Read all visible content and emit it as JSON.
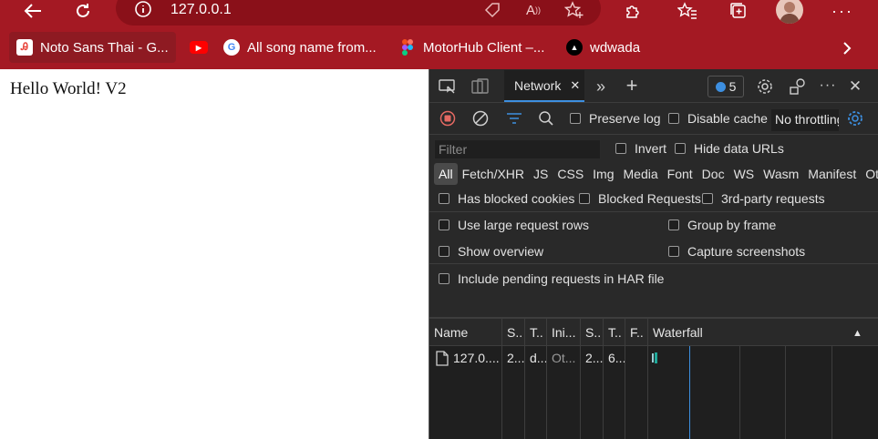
{
  "browser": {
    "address_url": "127.0.0.1",
    "bookmarks": [
      {
        "label": "Noto Sans Thai - G...",
        "icon": "google-fonts-icon"
      },
      {
        "label": "",
        "icon": "youtube-icon"
      },
      {
        "label": "All song name from...",
        "icon": "google-icon"
      },
      {
        "label": "MotorHub Client –...",
        "icon": "figma-icon"
      },
      {
        "label": "wdwada",
        "icon": "vercel-icon"
      }
    ],
    "theme_color": "#a41923"
  },
  "page": {
    "content_text": "Hello World! V2"
  },
  "devtools": {
    "active_tab": "Network",
    "issues_count": "5",
    "toolbar": {
      "preserve_log": "Preserve log",
      "disable_cache": "Disable cache",
      "throttling": "No throttling"
    },
    "filter": {
      "placeholder": "Filter",
      "invert": "Invert",
      "hide_data_urls": "Hide data URLs"
    },
    "types": [
      "All",
      "Fetch/XHR",
      "JS",
      "CSS",
      "Img",
      "Media",
      "Font",
      "Doc",
      "WS",
      "Wasm",
      "Manifest",
      "Other"
    ],
    "blocked": {
      "has_blocked_cookies": "Has blocked cookies",
      "blocked_requests": "Blocked Requests",
      "third_party": "3rd-party requests"
    },
    "settings": {
      "large_rows": "Use large request rows",
      "group_by_frame": "Group by frame",
      "show_overview": "Show overview",
      "capture_screenshots": "Capture screenshots",
      "include_pending": "Include pending requests in HAR file"
    },
    "table": {
      "headers": [
        "Name",
        "S..",
        "T..",
        "Ini...",
        "S..",
        "T..",
        "F..",
        "Waterfall"
      ],
      "rows": [
        [
          "127.0....",
          "2...",
          "d...",
          "Ot...",
          "2...",
          "6...",
          "",
          ""
        ]
      ]
    }
  }
}
